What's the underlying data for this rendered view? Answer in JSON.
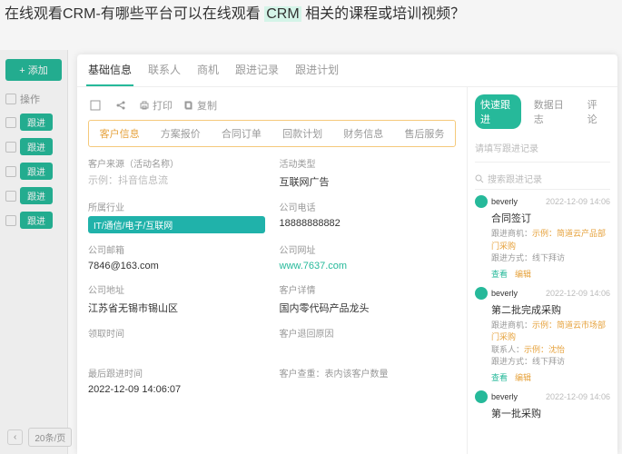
{
  "overlay": {
    "pre": "在线观看CRM-有哪些平台可以在线观看 ",
    "hl": "CRM",
    "post": " 相关的课程或培训视频？"
  },
  "sidebar": {
    "add": "+ 添加",
    "header": "操作",
    "btns": [
      "跟进",
      "跟进",
      "跟进",
      "跟进",
      "跟进"
    ]
  },
  "modal": {
    "tabs": [
      "基础信息",
      "联系人",
      "商机",
      "跟进记录",
      "跟进计划"
    ]
  },
  "toolbar": {
    "print": "打印",
    "copy": "复制"
  },
  "subtabs": [
    "客户信息",
    "方案报价",
    "合同订单",
    "回款计划",
    "财务信息",
    "售后服务"
  ],
  "fields": {
    "source_label": "客户来源（活动名称）",
    "source_value": "示例：抖音信息流",
    "type_label": "活动类型",
    "type_value": "互联网广告",
    "industry_label": "所属行业",
    "industry_value": "IT/通信/电子/互联网",
    "phone_label": "公司电话",
    "phone_value": "18888888882",
    "email_label": "公司邮箱",
    "email_value": "7846@163.com",
    "website_label": "公司网址",
    "website_value": "www.7637.com",
    "address_label": "公司地址",
    "address_value": "江苏省无锡市锡山区",
    "detail_label": "客户详情",
    "detail_value": "国内零代码产品龙头",
    "claim_label": "领取时间",
    "return_label": "客户退回原因",
    "last_label": "最后跟进时间",
    "last_value": "2022-12-09 14:06:07",
    "dup_label": "客户查重：表内该客户数量"
  },
  "right": {
    "tabs": [
      "快速跟进",
      "数据日志",
      "评论"
    ],
    "placeholder": "请填写跟进记录",
    "search": "搜索跟进记录"
  },
  "logs": [
    {
      "user": "beverly",
      "time": "2022-12-09 14:06",
      "title": "合同签订",
      "line1_label": "跟进商机：",
      "line1_value": "示例：简道云产品部门采购",
      "line2_label": "跟进方式：",
      "line2_value": "线下拜访",
      "view": "查看",
      "edit": "编辑"
    },
    {
      "user": "beverly",
      "time": "2022-12-09 14:06",
      "title": "第二批完成采购",
      "line1_label": "跟进商机：",
      "line1_value": "示例：简道云市场部门采购",
      "line2_label": "联系人：",
      "line2_value": "示例：沈怡",
      "line3_label": "跟进方式：",
      "line3_value": "线下拜访",
      "view": "查看",
      "edit": "编辑"
    },
    {
      "user": "beverly",
      "time": "2022-12-09 14:06",
      "title": "第一批采购"
    }
  ],
  "pager": {
    "size": "20条/页"
  }
}
